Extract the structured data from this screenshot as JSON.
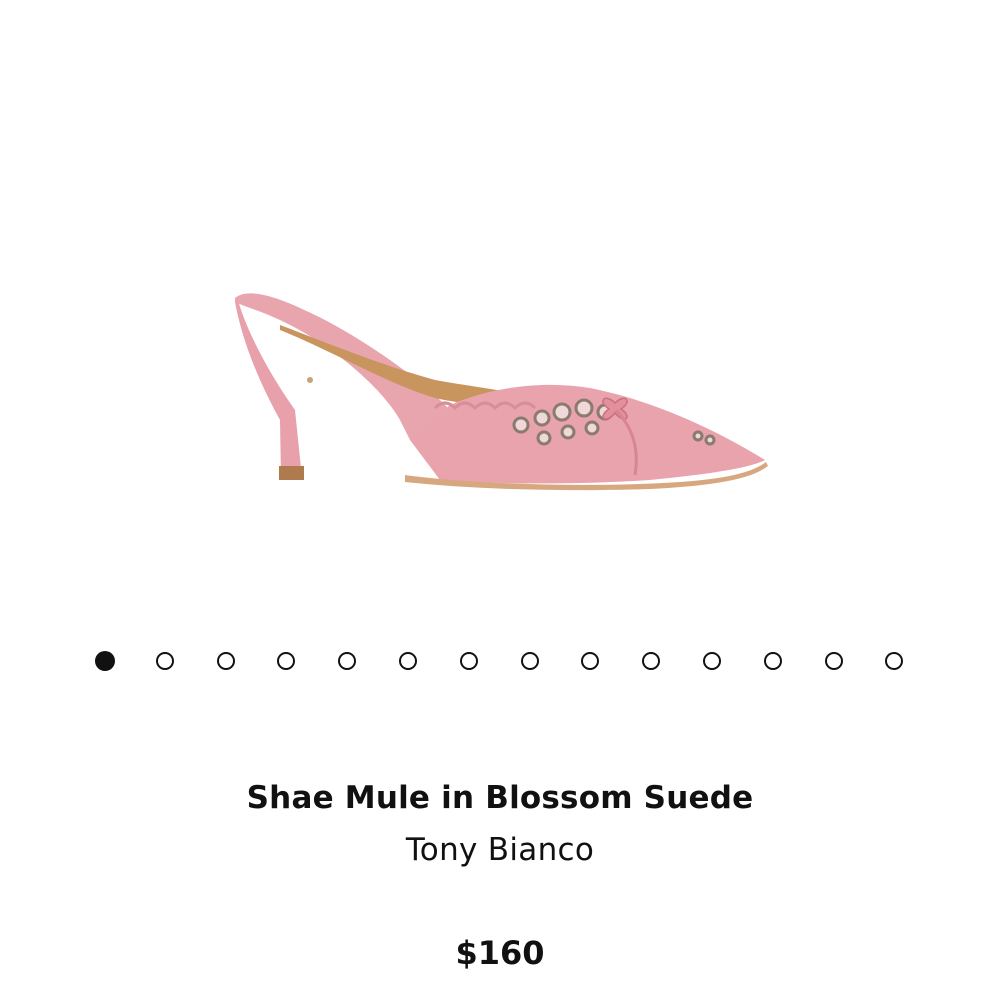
{
  "product": {
    "name": "Shae Mule in Blossom Suede",
    "brand": "Tony Bianco",
    "price": "$160",
    "color": "#e8a0a8",
    "image_icon": "pink-pointed-toe-mule-with-eyelets"
  },
  "gallery": {
    "image_count": 14,
    "active_index": 0
  }
}
